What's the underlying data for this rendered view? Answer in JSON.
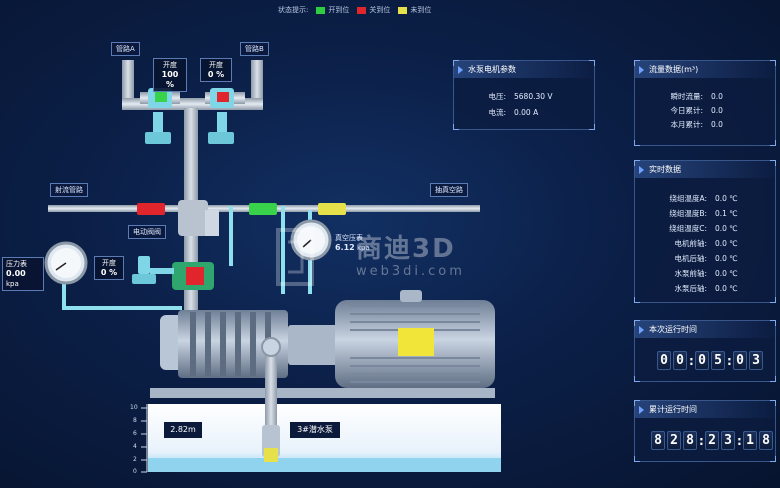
{
  "status_bar": {
    "label": "状态提示:",
    "items": [
      {
        "label": "开到位",
        "color": "#2ecc40"
      },
      {
        "label": "关到位",
        "color": "#e0262c"
      },
      {
        "label": "未到位",
        "color": "#e6e04a"
      }
    ]
  },
  "pipes": {
    "pipe_a": "管路A",
    "pipe_b": "管路B",
    "shoot_pipe": "射流管路",
    "vacuum_pipe": "抽真空路",
    "electric_valve": "电动阀阀"
  },
  "valve_a": {
    "label": "开度",
    "value": "100 %"
  },
  "valve_b": {
    "label": "开度",
    "value": "0 %"
  },
  "gauge_left": {
    "label": "压力表",
    "value": "0.00",
    "unit": "kpa"
  },
  "valve_small": {
    "label": "开度",
    "value": "0 %"
  },
  "vacuum_gauge": {
    "label": "真空压表",
    "value": "6.12",
    "unit": "kpa"
  },
  "tank": {
    "level_value": "2.82m",
    "pump_name": "3#潜水泵",
    "scale": [
      "10",
      "8",
      "6",
      "4",
      "2",
      "0"
    ]
  },
  "motor_panel": {
    "title": "水泵电机参数",
    "rows": [
      {
        "key": "电压:",
        "value": "5680.30 V"
      },
      {
        "key": "电流:",
        "value": "0.00 A"
      }
    ]
  },
  "flow_panel": {
    "title": "流量数据(m³)",
    "rows": [
      {
        "key": "瞬时流量:",
        "value": "0.0"
      },
      {
        "key": "今日累计:",
        "value": "0.0"
      },
      {
        "key": "本月累计:",
        "value": "0.0"
      }
    ]
  },
  "realtime_panel": {
    "title": "实时数据",
    "rows": [
      {
        "key": "绕组温度A:",
        "value": "0.0 ℃"
      },
      {
        "key": "绕组温度B:",
        "value": "0.1 ℃"
      },
      {
        "key": "绕组温度C:",
        "value": "0.0 ℃"
      },
      {
        "key": "电机前轴:",
        "value": "0.0 ℃"
      },
      {
        "key": "电机后轴:",
        "value": "0.0 ℃"
      },
      {
        "key": "水泵前轴:",
        "value": "0.0 ℃"
      },
      {
        "key": "水泵后轴:",
        "value": "0.0 ℃"
      }
    ]
  },
  "run_time_panel": {
    "title": "本次运行时间",
    "digits": [
      "0",
      "0",
      "0",
      "5",
      "0",
      "3"
    ]
  },
  "total_time_panel": {
    "title": "累计运行时间",
    "digits": [
      "8",
      "2",
      "8",
      "2",
      "3",
      "1",
      "8"
    ]
  },
  "watermark": {
    "brand": "商迪3D",
    "url": "web3di.com"
  }
}
